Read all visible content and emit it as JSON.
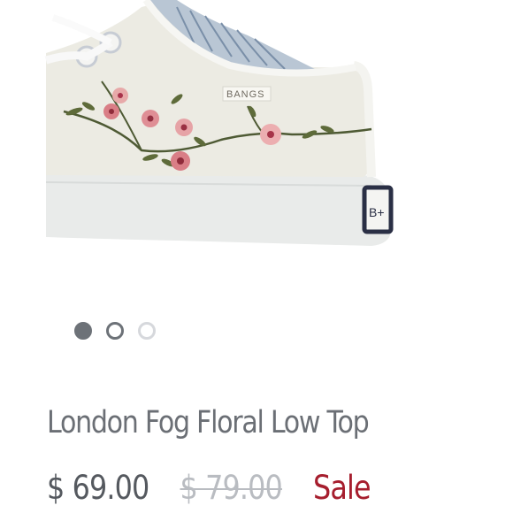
{
  "product": {
    "brand_tag": "BANGS",
    "heel_badge": "B+",
    "title": "London Fog Floral Low Top",
    "price_current": "$ 69.00",
    "price_original": "$ 79.00",
    "sale_label": "Sale"
  },
  "carousel": {
    "total_slides": 3,
    "active_index": 0
  },
  "colors": {
    "sale": "#a61e2e",
    "title": "#6b6f75",
    "dot_active": "#6d7278"
  }
}
